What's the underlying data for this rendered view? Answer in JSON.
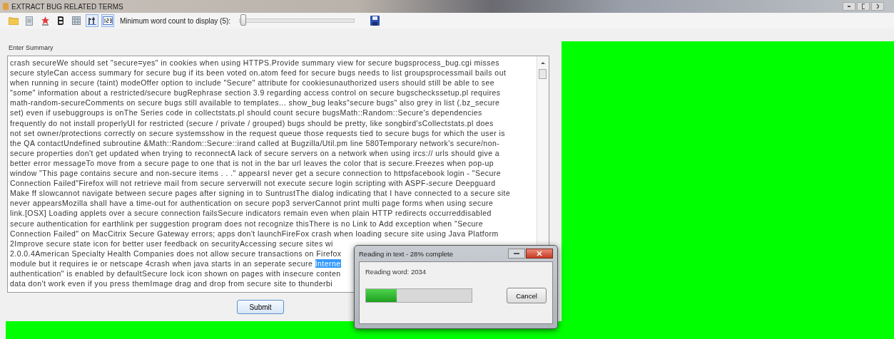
{
  "window": {
    "title": "EXTRACT BUG RELATED TERMS"
  },
  "toolbar": {
    "buttons": [
      {
        "kind": "open",
        "pressed": false
      },
      {
        "kind": "document",
        "pressed": false
      },
      {
        "kind": "bug",
        "pressed": false
      },
      {
        "kind": "bold",
        "pressed": false
      },
      {
        "kind": "grid",
        "pressed": false
      },
      {
        "kind": "rt",
        "pressed": true
      },
      {
        "kind": "numbers",
        "pressed": true
      }
    ],
    "slider": {
      "label": "Minimum word count to display (5):",
      "level": 0.03
    },
    "save": {
      "kind": "save"
    }
  },
  "summary": {
    "label": "Enter Summary",
    "lines": [
      {
        "text": "crash secureWe should set \"secure=yes\" in cookies when using HTTPS.Provide summary view for secure bugsprocess_bug.cgi misses"
      },
      {
        "text": "secure styleCan access summary for secure bug if its been voted on.atom feed for secure bugs needs to list groupsprocessmail bails out"
      },
      {
        "text": "when running in secure (taint) modeOffer option to include \"Secure\" attribute for cookiesunauthorized users should still be able to see"
      },
      {
        "text": "\"some\" information about a restricted/secure bugRephrase section 3.9 regarding access control on secure bugscheckssetup.pl requires"
      },
      {
        "text": "math-random-secureComments on secure bugs still available to templates... show_bug leaks\"secure bugs\" also grey in list (.bz_secure"
      },
      {
        "text": "set) even if usebuggroups is onThe Series code in collectstats.pl should count secure bugsMath::Random::Secure's dependencies"
      },
      {
        "text": "frequently do not install properlyUI for restricted (secure / private / grouped) bugs should be pretty, like songbird'sCollectstats.pl does"
      },
      {
        "text": "not set owner/protections correctly on secure systemsshow in the request queue those requests tied to secure bugs for which the user is"
      },
      {
        "text": "the QA contactUndefined subroutine &Math::Random::Secure::irand called at Bugzilla/Util.pm line 580Temporary network's secure/non-"
      },
      {
        "text": "secure properties don't get updated when trying to reconnectA lack of secure servers on a network when using ircs:// urls should give a"
      },
      {
        "text": "better error messageTo move from a secure page to one that is not in the bar url leaves the color that is secure.Freezes when pop-up"
      },
      {
        "text": "window \"This page contains secure and non-secure items . . .\" appearsI never get a secure connection to httpsfacebook login - \"Secure"
      },
      {
        "text": "Connection Failed\"Firefox will not retrieve mail from secure serverwill not execute secure login scripting with ASPF-secure Deepguard"
      },
      {
        "text": "Make ff slowcannot navigate between secure pages after signing in to SuntrustThe dialog indicating that I have connected to a secure site"
      },
      {
        "text": "never appearsMozilla shall have a time-out for authentication on secure pop3 serverCannot print multi page forms when using secure"
      },
      {
        "text": "link.[OSX] Loading applets over a secure connection failsSecure indicators remain even when plain HTTP redirects occurreddisabled"
      },
      {
        "text": "secure authentication for earthlink  per suggestion program does not recognize thisThere is no Link to Add exception when \"Secure"
      },
      {
        "text": "Connection Failed\" on MacCitrix Secure Gateway errors; apps don't launchFireFox crash when loading secure site using Java Platform"
      },
      {
        "text": "2Improve secure state icon for better user feedback on securityAccessing secure sites wi"
      },
      {
        "text": "2.0.0.4American Specialty Health Companies does not allow secure transactions on Firefox"
      },
      {
        "text": "module but it requires ie or netscape 4crash when java starts in an seperate secure ",
        "selection": "Interne"
      },
      {
        "text": "authentication\" is enabled by defaultSecure lock icon shown on pages with insecure conten"
      },
      {
        "text": "data don't work even if you press themImage drag and drop from secure site to thunderbi"
      }
    ],
    "submit": "Submit"
  },
  "progress_dialog": {
    "title": "Reading in text - 28% complete",
    "message": "Reading word: 2034",
    "level": 0.29,
    "cancel": "Cancel"
  }
}
